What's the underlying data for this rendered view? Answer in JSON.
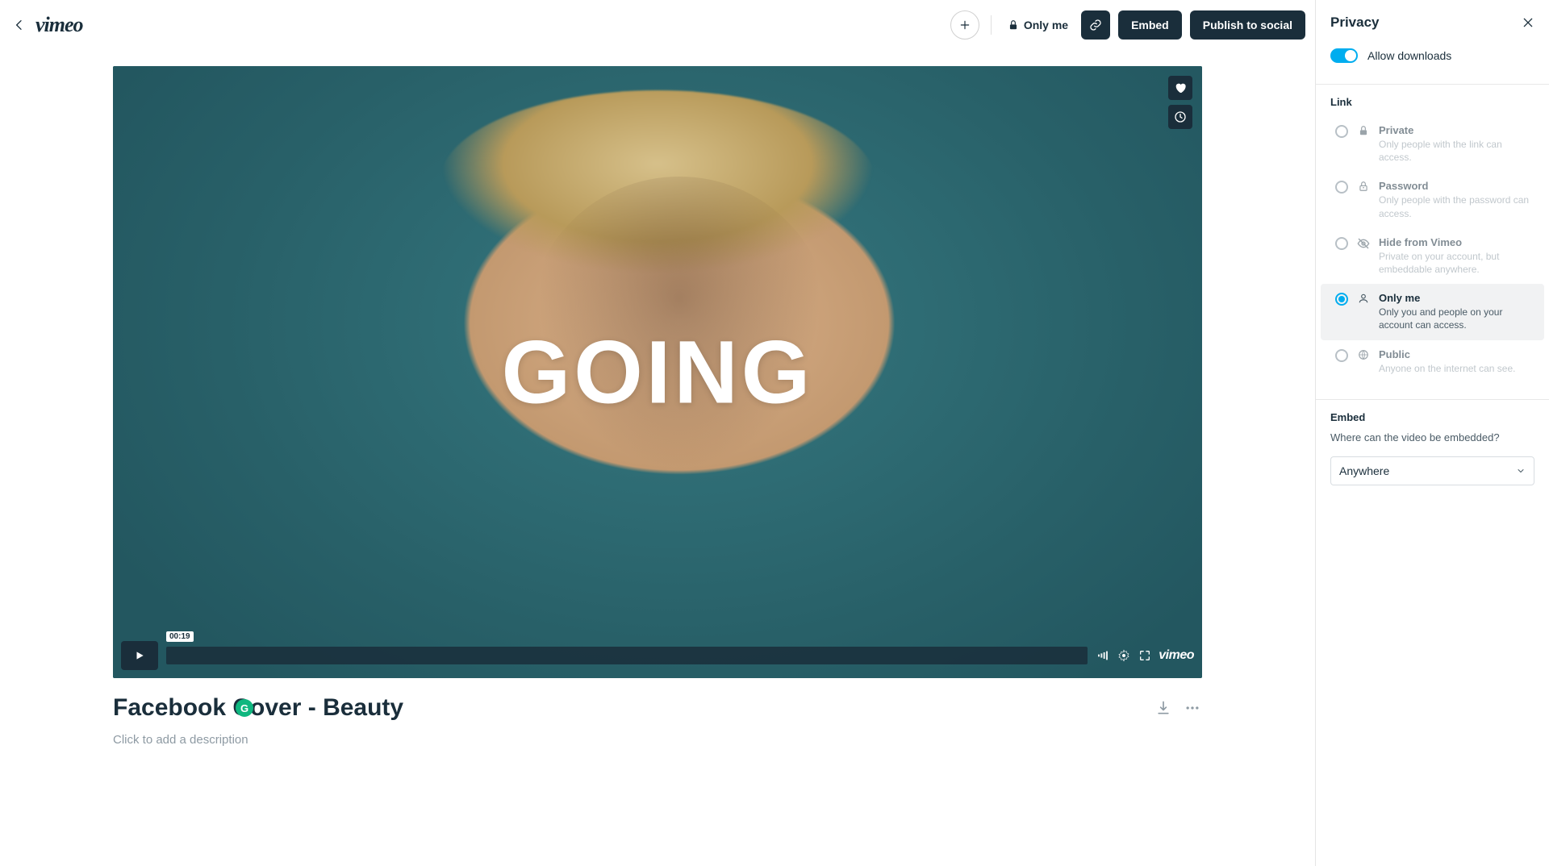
{
  "topbar": {
    "logo": "vimeo",
    "privacy_chip": "Only me",
    "embed_label": "Embed",
    "publish_label": "Publish to social"
  },
  "video": {
    "overlay_text": "GOING",
    "timestamp": "00:19",
    "brand": "vimeo"
  },
  "below": {
    "title": "Facebook Cover - Beauty",
    "badge_letter": "G",
    "description_placeholder": "Click to add a description"
  },
  "panel": {
    "title": "Privacy",
    "toggle_label": "Allow downloads",
    "link_section": "Link",
    "options": [
      {
        "title": "Private",
        "desc": "Only people with the link can access.",
        "icon": "lock"
      },
      {
        "title": "Password",
        "desc": "Only people with the password can access.",
        "icon": "lock-key"
      },
      {
        "title": "Hide from Vimeo",
        "desc": "Private on your account, but embeddable anywhere.",
        "icon": "eye-off"
      },
      {
        "title": "Only me",
        "desc": "Only you and people on your account can access.",
        "icon": "person"
      },
      {
        "title": "Public",
        "desc": "Anyone on the internet can see.",
        "icon": "globe"
      }
    ],
    "selected_index": 3,
    "embed_section": "Embed",
    "embed_question": "Where can the video be embedded?",
    "embed_value": "Anywhere"
  }
}
